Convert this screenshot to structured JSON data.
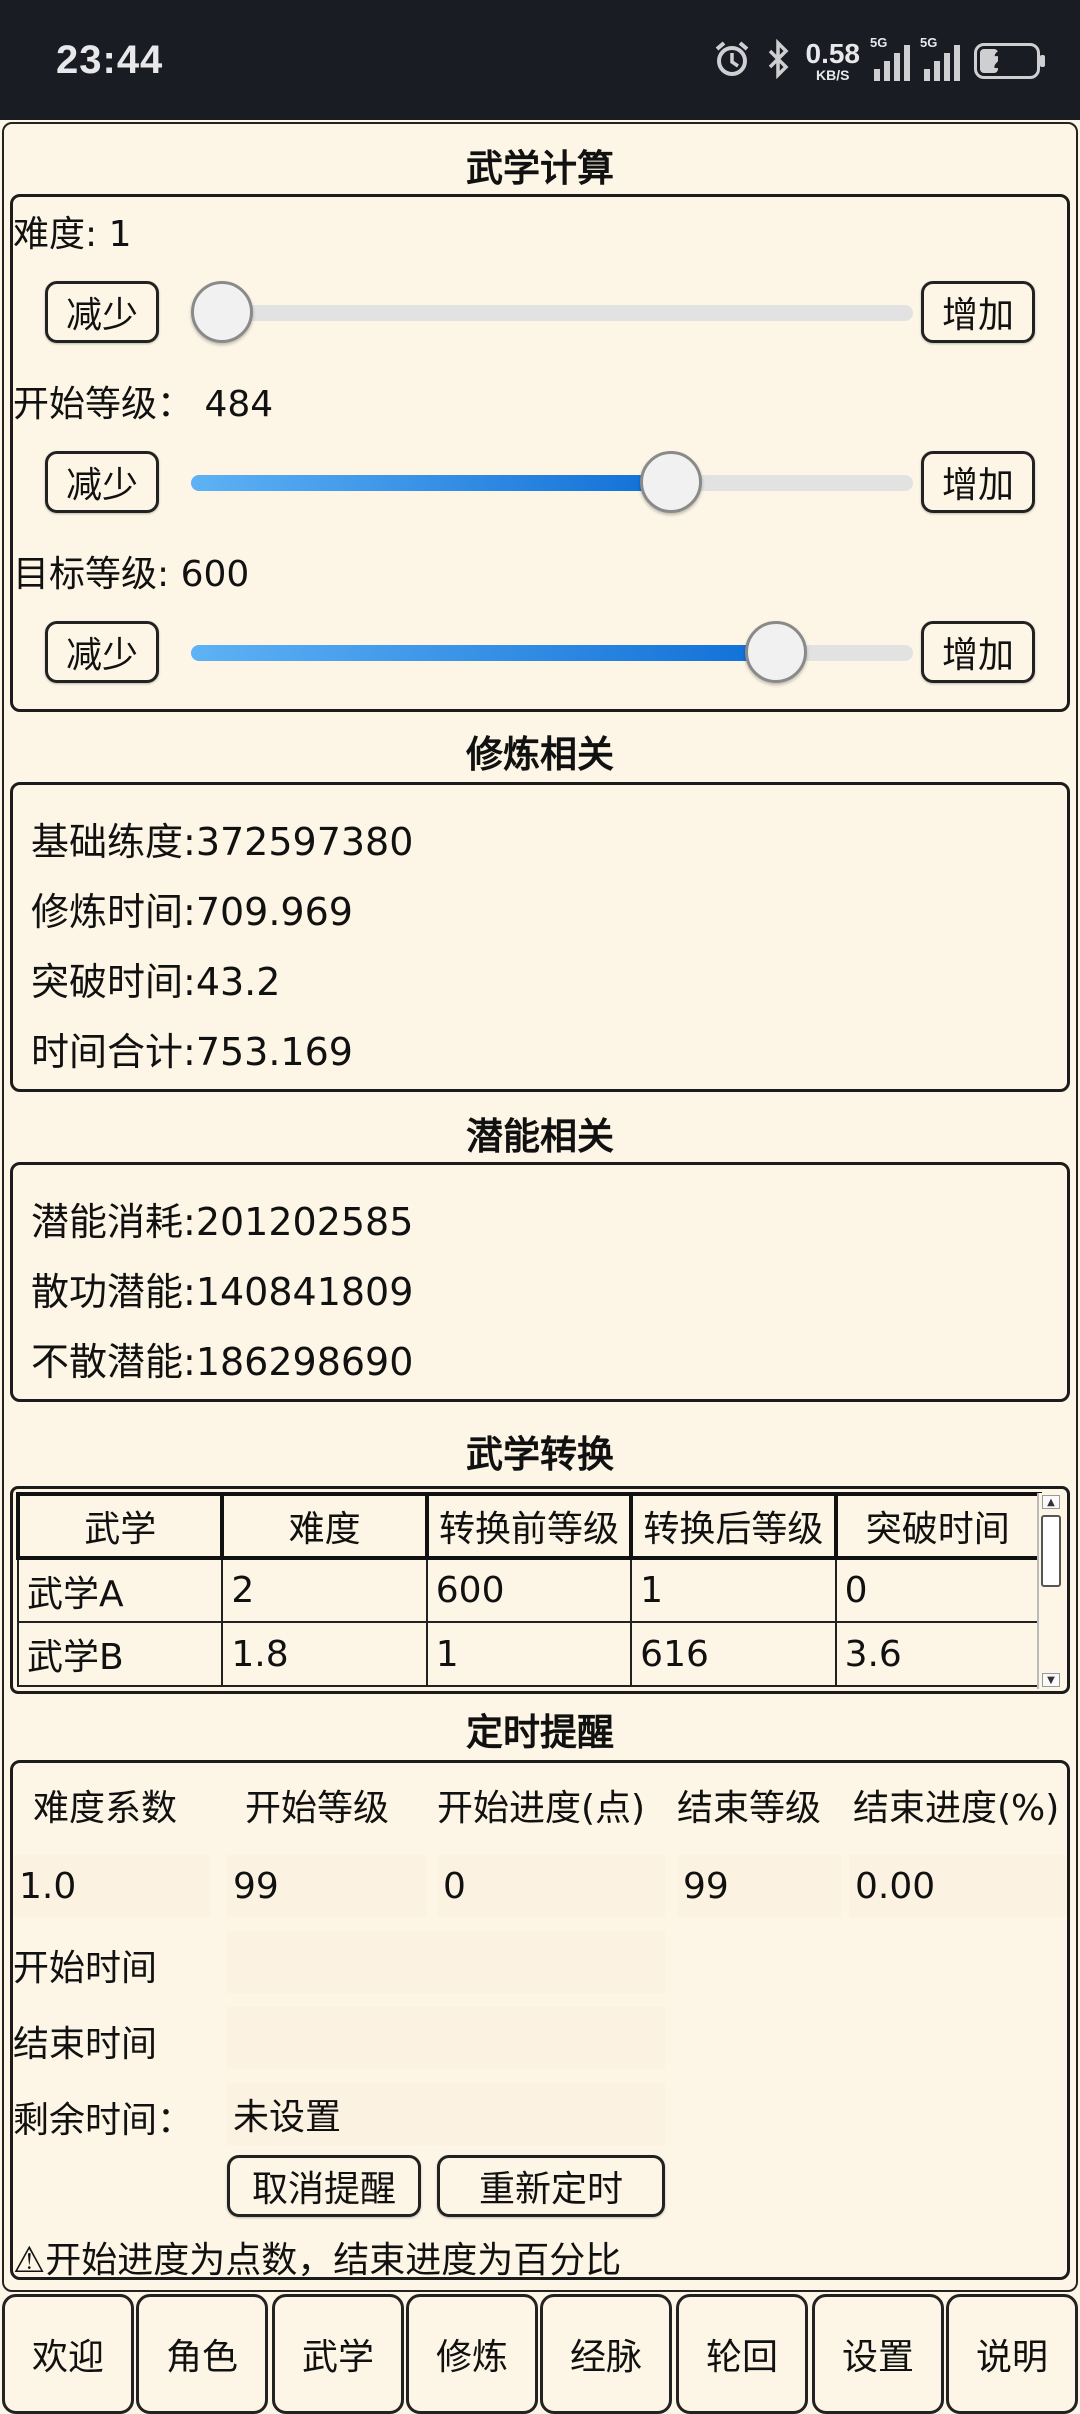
{
  "status_bar": {
    "time": "23:44",
    "net_speed_value": "0.58",
    "net_speed_unit": "KB/S",
    "sim1_label": "5G",
    "sim2_label": "5G",
    "battery": "25",
    "icons": [
      "alarm-icon",
      "bluetooth-icon",
      "signal-icon",
      "battery-icon"
    ]
  },
  "calc": {
    "title": "武学计算",
    "difficulty_label": "难度:",
    "difficulty_value": "1",
    "start_level_label": "开始等级：",
    "start_level_value": "484",
    "target_level_label": "目标等级:",
    "target_level_value": "600",
    "decrease_label": "减少",
    "increase_label": "增加",
    "slider_levels": {
      "difficulty": 0.0,
      "start_level": 0.68,
      "target_level": 0.84
    }
  },
  "training": {
    "title": "修炼相关",
    "base_label": "基础练度:",
    "base_value": "372597380",
    "train_time_label": "修炼时间:",
    "train_time_value": "709.969",
    "break_time_label": "突破时间:",
    "break_time_value": "43.2",
    "total_label": "时间合计:",
    "total_value": "753.169"
  },
  "potential": {
    "title": "潜能相关",
    "consume_label": "潜能消耗:",
    "consume_value": "201202585",
    "dispersed_label": "散功潜能:",
    "dispersed_value": "140841809",
    "kept_label": "不散潜能:",
    "kept_value": "186298690"
  },
  "conversion": {
    "title": "武学转换",
    "headers": [
      "武学",
      "难度",
      "转换前等级",
      "转换后等级",
      "突破时间"
    ],
    "rows": [
      [
        "武学A",
        "2",
        "600",
        "1",
        "0"
      ],
      [
        "武学B",
        "1.8",
        "1",
        "616",
        "3.6"
      ]
    ]
  },
  "reminder": {
    "title": "定时提醒",
    "headers": [
      "难度系数",
      "开始等级",
      "开始进度(点)",
      "结束等级",
      "结束进度(%)"
    ],
    "values": [
      "1.0",
      "99",
      "0",
      "99",
      "0.00"
    ],
    "start_time_label": "开始时间",
    "start_time_value": "",
    "end_time_label": "结束时间",
    "end_time_value": "",
    "remaining_label": "剩余时间：",
    "remaining_value": "未设置",
    "cancel_label": "取消提醒",
    "reset_label": "重新定时",
    "note": "⚠开始进度为点数，结束进度为百分比"
  },
  "nav": [
    "欢迎",
    "角色",
    "武学",
    "修炼",
    "经脉",
    "轮回",
    "设置",
    "说明"
  ],
  "colors": {
    "background": "#fdf6e6",
    "slider_fill": "#1a7fe0",
    "status_bar": "#1a1c23"
  }
}
